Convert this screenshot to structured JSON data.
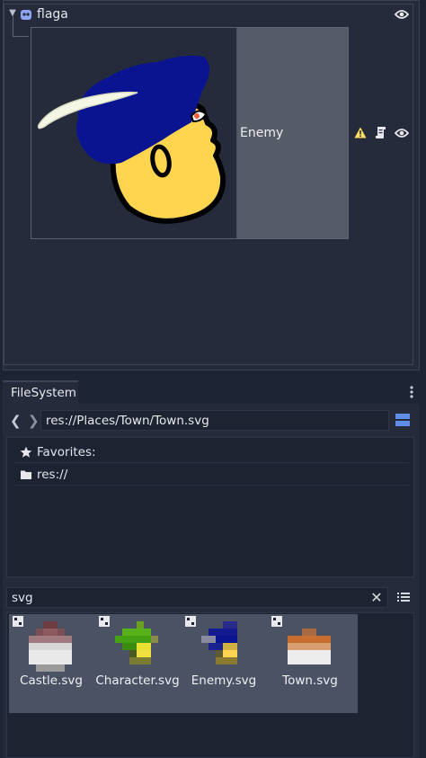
{
  "scene": {
    "node_name": "flaga",
    "preview_label": "Enemy",
    "icons": {
      "node": "node-2d-icon",
      "visibility": "eye-icon",
      "warning": "warning-icon",
      "script": "script-icon"
    }
  },
  "filesystem": {
    "tab_label": "FileSystem",
    "path": "res://Places/Town/Town.svg",
    "tree": [
      {
        "label": "Favorites:",
        "icon": "star-icon"
      },
      {
        "label": "res://",
        "icon": "folder-icon"
      }
    ],
    "filter_value": "svg",
    "files": [
      {
        "name": "Castle.svg"
      },
      {
        "name": "Character.svg"
      },
      {
        "name": "Enemy.svg"
      },
      {
        "name": "Town.svg"
      }
    ]
  },
  "colors": {
    "background": "#1d2433",
    "panel": "#252b3a",
    "selection": "#4b5264",
    "node_icon": "#8da5f3",
    "warning": "#ffdd65"
  }
}
